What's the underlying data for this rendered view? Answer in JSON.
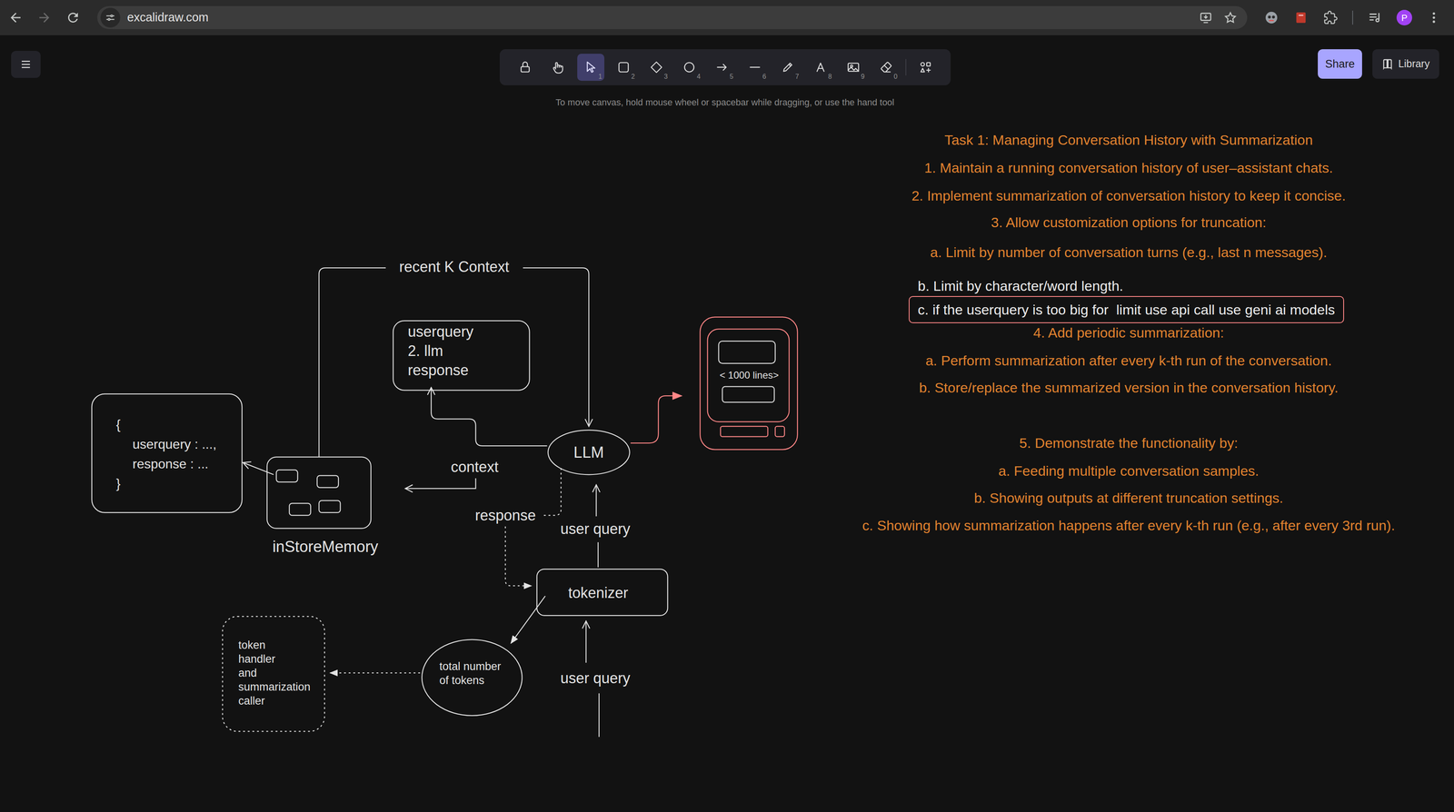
{
  "browser": {
    "url": "excalidraw.com",
    "profile": "P"
  },
  "toolbar": {
    "tools": [
      {
        "kind": "lock",
        "selected": false
      },
      {
        "kind": "hand",
        "selected": false
      },
      {
        "kind": "select",
        "shortcut": "1",
        "selected": true
      },
      {
        "kind": "rectangle",
        "shortcut": "2",
        "selected": false
      },
      {
        "kind": "diamond",
        "shortcut": "3",
        "selected": false
      },
      {
        "kind": "ellipse",
        "shortcut": "4",
        "selected": false
      },
      {
        "kind": "arrow",
        "shortcut": "5",
        "selected": false
      },
      {
        "kind": "line",
        "shortcut": "6",
        "selected": false
      },
      {
        "kind": "draw",
        "shortcut": "7",
        "selected": false
      },
      {
        "kind": "text",
        "shortcut": "8",
        "selected": false
      },
      {
        "kind": "image",
        "shortcut": "9",
        "selected": false
      },
      {
        "kind": "eraser",
        "shortcut": "0",
        "selected": false
      },
      {
        "kind": "extra",
        "selected": false
      }
    ]
  },
  "hint": "To move canvas, hold mouse wheel or spacebar while dragging, or use the hand tool",
  "share": "Share",
  "library": "Library",
  "diagram": {
    "memory_record": [
      "{",
      "userquery : ...,",
      "response : ...",
      "}"
    ],
    "memory_store": "inStoreMemory",
    "recent_context": "recent K Context",
    "context_box": [
      "userquery",
      "2. llm",
      "response"
    ],
    "llm": "LLM",
    "context": "context",
    "response": "response",
    "user_query_to_llm": "user query",
    "tokenizer": "tokenizer",
    "user_query_input": "user query",
    "token_count": [
      "total number",
      "of tokens"
    ],
    "token_handler": [
      "token",
      "handler",
      "and",
      "summarization",
      "caller"
    ],
    "api_model": "< 1000 lines>"
  },
  "task": {
    "lines": [
      {
        "text": "Task 1: Managing Conversation History with Summarization",
        "kind": "text"
      },
      {
        "text": "1. Maintain a running conversation history of user–assistant chats.",
        "kind": "text"
      },
      {
        "text": "2. Implement summarization of conversation history to keep it concise.",
        "kind": "text"
      },
      {
        "text": "3. Allow customization options for truncation:",
        "kind": "text"
      },
      {
        "text": "a. Limit by number of conversation turns (e.g., last n messages).",
        "kind": "text"
      },
      {
        "text": "b. Limit by character/word length.",
        "kind": "note"
      },
      {
        "text": "c. if the userquery is too big for  limit use api call use geni ai models",
        "kind": "boxed-note"
      },
      {
        "text": "4. Add periodic summarization:",
        "kind": "text"
      },
      {
        "text": "a. Perform summarization after every k-th run of the conversation.",
        "kind": "text"
      },
      {
        "text": "b. Store/replace the summarized version in the conversation history.",
        "kind": "text"
      },
      {
        "text": "5. Demonstrate the functionality by:",
        "kind": "text"
      },
      {
        "text": "a. Feeding multiple conversation samples.",
        "kind": "text"
      },
      {
        "text": "b. Showing outputs at different truncation settings.",
        "kind": "text"
      },
      {
        "text": "c. Showing how summarization happens after every k-th run (e.g., after every 3rd run).",
        "kind": "text"
      }
    ]
  }
}
